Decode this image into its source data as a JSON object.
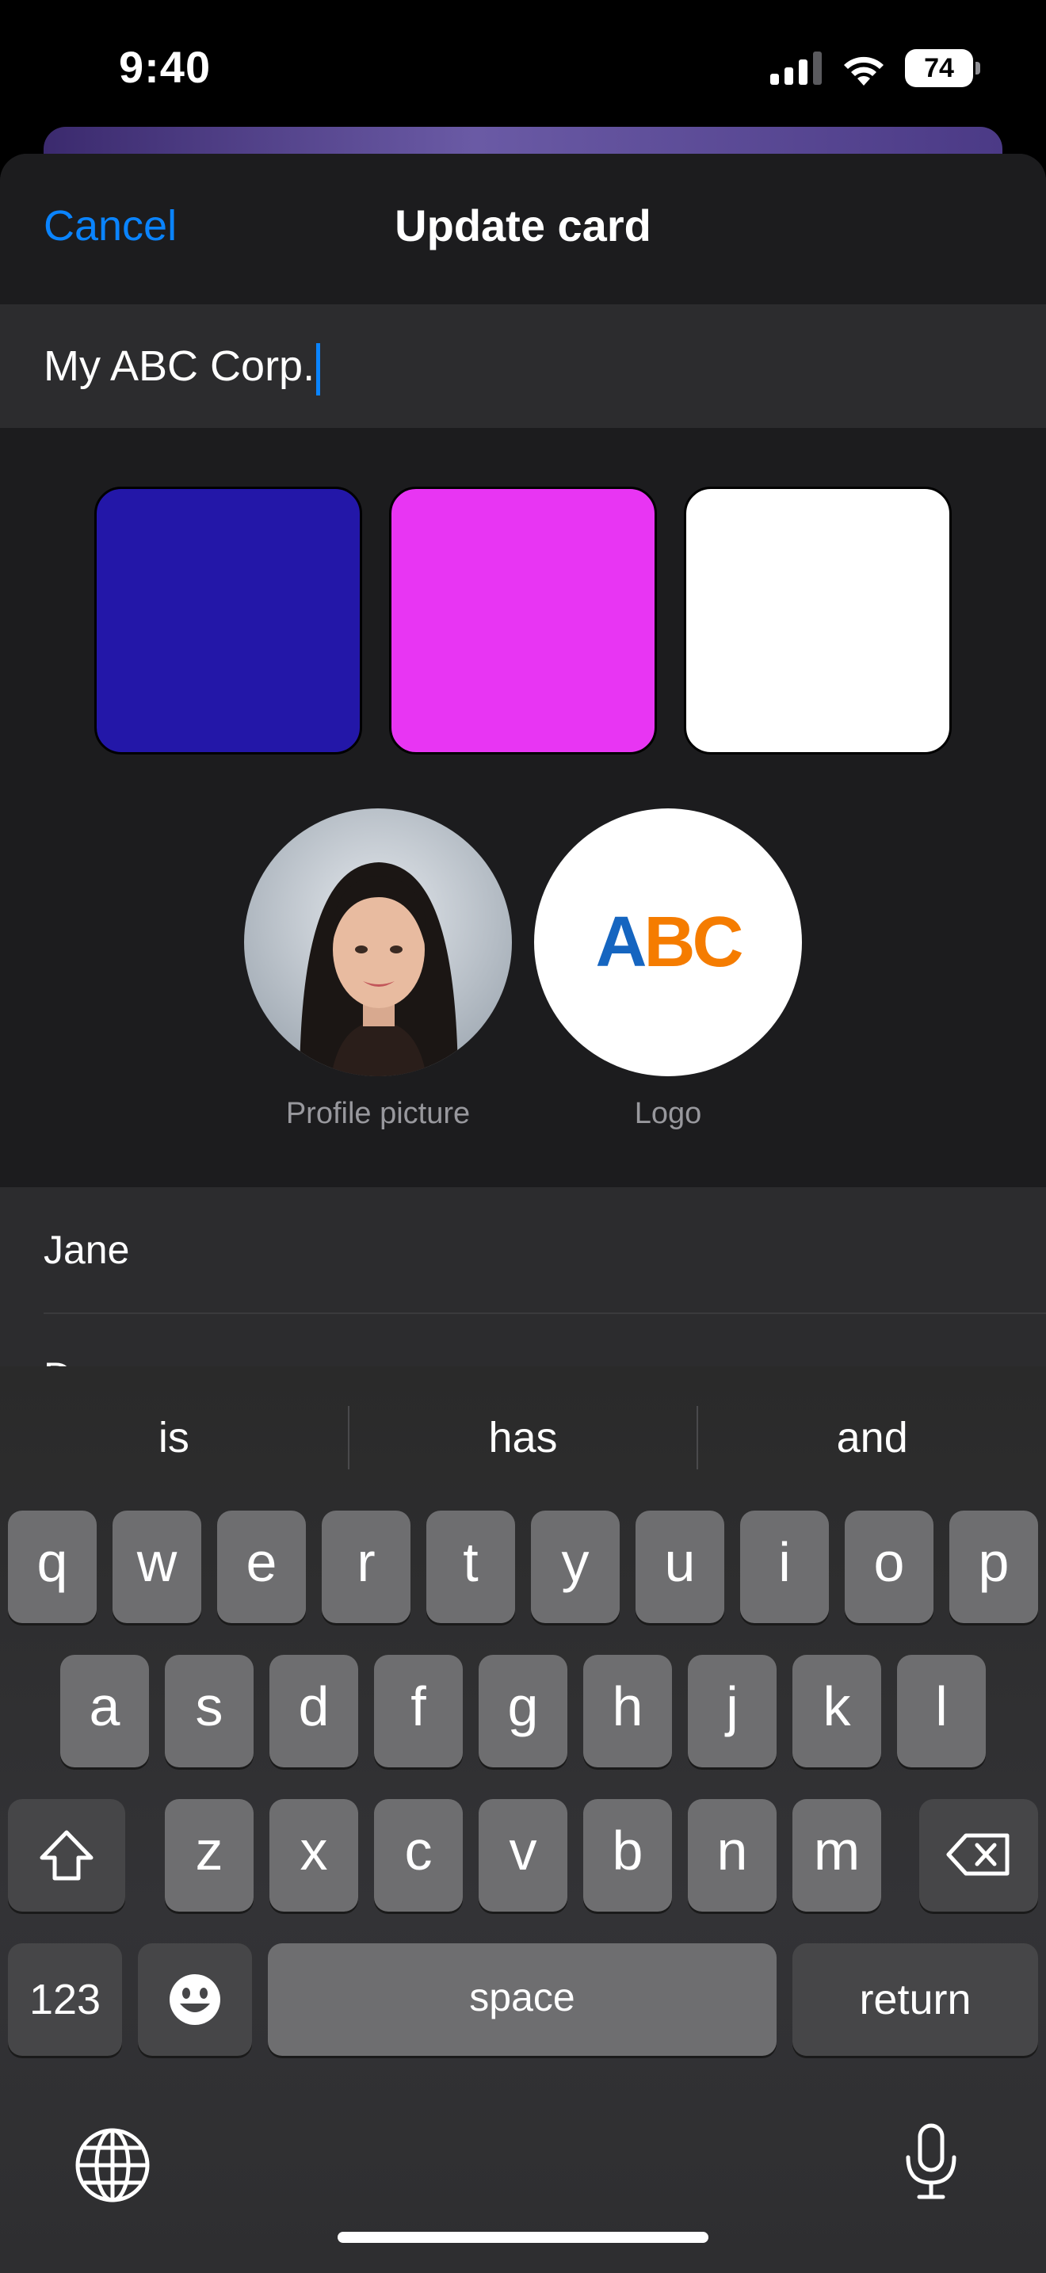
{
  "status_bar": {
    "time": "9:40",
    "battery": "74"
  },
  "nav": {
    "cancel_label": "Cancel",
    "title": "Update card"
  },
  "card_name": {
    "value": "My ABC Corp."
  },
  "color_swatches": [
    {
      "name": "indigo",
      "color": "#2317a8"
    },
    {
      "name": "magenta",
      "color": "#e835f3"
    },
    {
      "name": "white",
      "color": "#ffffff"
    }
  ],
  "images": {
    "profile_label": "Profile picture",
    "logo_label": "Logo",
    "logo_text_a": "A",
    "logo_text_bc": "BC"
  },
  "fields": {
    "first_name": "Jane",
    "last_name_partial": "D"
  },
  "keyboard": {
    "suggestions": [
      "is",
      "has",
      "and"
    ],
    "row1": [
      "q",
      "w",
      "e",
      "r",
      "t",
      "y",
      "u",
      "i",
      "o",
      "p"
    ],
    "row2": [
      "a",
      "s",
      "d",
      "f",
      "g",
      "h",
      "j",
      "k",
      "l"
    ],
    "row3": [
      "z",
      "x",
      "c",
      "v",
      "b",
      "n",
      "m"
    ],
    "numbers_label": "123",
    "space_label": "space",
    "return_label": "return"
  },
  "colors": {
    "accent": "#0a84ff",
    "sheet_bg": "#1c1c1e",
    "field_bg": "#2c2c2e",
    "logo_blue": "#1565c0",
    "logo_orange": "#f57c00"
  }
}
